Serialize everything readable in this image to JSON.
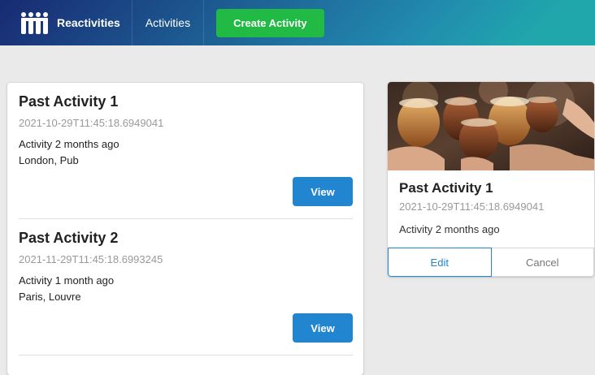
{
  "navbar": {
    "brand_name": "Reactivities",
    "activities_label": "Activities",
    "create_label": "Create Activity",
    "logo_icon": "group-of-people-icon",
    "gradient_colors": [
      "#182a73",
      "#218aae",
      "#20a7ac"
    ]
  },
  "activities": [
    {
      "title": "Past Activity 1",
      "date": "2021-10-29T11:45:18.6949041",
      "description": "Activity 2 months ago",
      "venue": "London, Pub",
      "view_label": "View"
    },
    {
      "title": "Past Activity 2",
      "date": "2021-11-29T11:45:18.6993245",
      "description": "Activity 1 month ago",
      "venue": "Paris, Louvre",
      "view_label": "View"
    }
  ],
  "detail": {
    "image_icon": "drinks-photo",
    "title": "Past Activity 1",
    "date": "2021-10-29T11:45:18.6949041",
    "description": "Activity 2 months ago",
    "edit_label": "Edit",
    "cancel_label": "Cancel"
  },
  "colors": {
    "primary": "#2185d0",
    "positive": "#21ba45",
    "page_background": "#eaeaea",
    "muted_text": "#999999"
  }
}
